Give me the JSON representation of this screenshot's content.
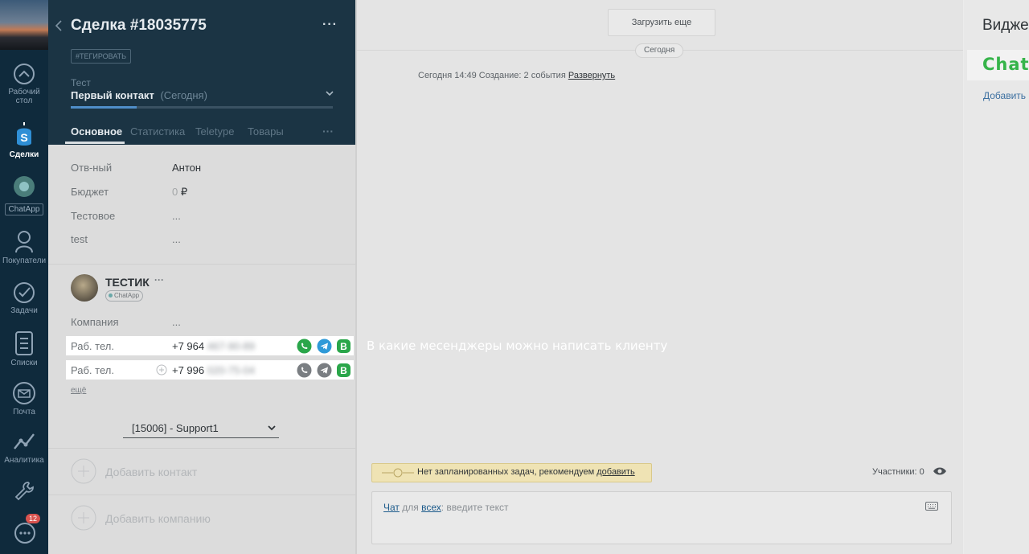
{
  "nav": {
    "items": [
      {
        "label": "Рабочий стол",
        "icon": "dashboard-icon"
      },
      {
        "label": "Сделки",
        "icon": "deals-icon"
      },
      {
        "label": "ChatApp",
        "icon": "chatapp-icon"
      },
      {
        "label": "Покупатели",
        "icon": "customers-icon"
      },
      {
        "label": "Задачи",
        "icon": "tasks-icon"
      },
      {
        "label": "Списки",
        "icon": "lists-icon"
      },
      {
        "label": "Почта",
        "icon": "mail-icon"
      },
      {
        "label": "Аналитика",
        "icon": "analytics-icon"
      }
    ],
    "chat_badge": "12"
  },
  "deal": {
    "title": "Сделка #18035775",
    "tag": "#ТЕГИРОВАТЬ",
    "pipeline_label": "Тест",
    "stage": "Первый контакт",
    "stage_date": "(Сегодня)",
    "tabs": [
      "Основное",
      "Статистика",
      "Teletype",
      "Товары"
    ],
    "fields": [
      {
        "label": "Отв-ный",
        "value": "Антон"
      },
      {
        "label": "Бюджет",
        "value": "0",
        "currency": "₽"
      },
      {
        "label": "Тестовое",
        "value": "..."
      },
      {
        "label": "test",
        "value": "..."
      }
    ]
  },
  "contact": {
    "name": "ТЕСТИК",
    "badge": "ChatApp",
    "company_label": "Компания",
    "company_value": "...",
    "phones": [
      {
        "label": "Раб. тел.",
        "prefix": "+7 964",
        "hidden": "467-90-89"
      },
      {
        "label": "Раб. тел.",
        "prefix": "+7 996",
        "hidden": "020-75-04"
      }
    ],
    "more_link": "ещё",
    "select_value": "[15006] - Support1",
    "add_contact": "Добавить контакт",
    "add_company": "Добавить компанию"
  },
  "feed": {
    "load_more": "Загрузить еще",
    "day_label": "Сегодня",
    "event_text": "Сегодня 14:49 Создание: 2 события",
    "event_link": "Развернуть",
    "annotation": "В какие месенджеры можно написать клиенту",
    "task_notice": "Нет запланированных задач, рекомендуем",
    "task_link": "добавить",
    "participants": "Участники: 0",
    "chat_label": "Чат",
    "chat_for": "для",
    "chat_all": "всех",
    "chat_placeholder": ": введите текст"
  },
  "widgets": {
    "title": "Видже",
    "logo_text": "ChatA",
    "add_link": "Добавить"
  }
}
